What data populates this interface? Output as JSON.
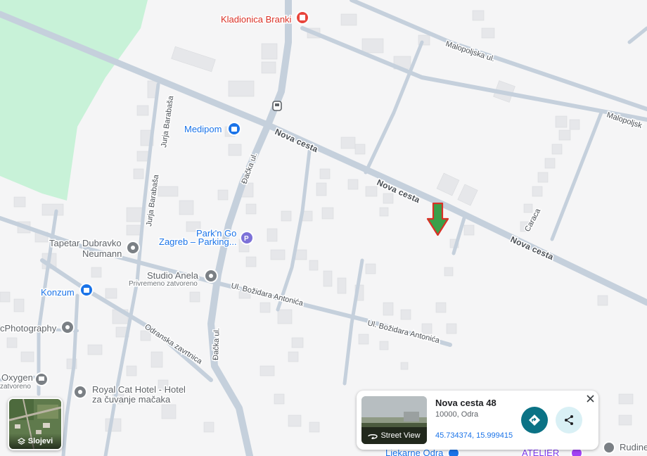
{
  "map": {
    "poi": {
      "kladionica": "Kladionica Branki",
      "medipom": "Medipom",
      "parkngo_line1": "Park'n Go",
      "parkngo_line2": "Zagreb – Parking...",
      "tapetar_line1": "Tapetar Dubravko",
      "tapetar_line2": "Neumann",
      "studio_anela": "Studio Anela",
      "studio_anela_status": "Privremeno zatvoreno",
      "konzum": "Konzum",
      "photography": "cPhotography",
      "oxygen": "Oxygen",
      "oxygen_status": "zatvoreno",
      "royal_cat_line1": "Royal Cat Hotel - Hotel",
      "royal_cat_line2": "za čuvanje mačaka",
      "ljekarne": "Ljekarne Odra",
      "atelier": "ATELIER",
      "rudine": "Rudine"
    },
    "roads": {
      "nova_cesta": "Nova cesta",
      "malopoljska_ul": "Malopoljska ul.",
      "malopoljska_short": "Malopoljsk",
      "dacka_ul": "Đačka ul.",
      "jurja_barabasa": "Jurja Barabaša",
      "ul_bozidara_antonica": "Ul. Božidara Antonića",
      "odranska_zavrtnica": "Odranska zavrtnica",
      "caraca": "Caraca"
    },
    "colors": {
      "background": "#f5f5f6",
      "road": "#c5d0dc",
      "park": "#c8f2d8",
      "building": "#e6e7ea",
      "marker_green": "#3aa04a",
      "marker_red": "#d93025"
    },
    "marker_icon": "green-arrow-down-marker"
  },
  "place_card": {
    "title": "Nova cesta 48",
    "subtitle": "10000, Odra",
    "coordinates": "45.734374, 15.999415",
    "street_view_label": "Street View",
    "close_icon": "close-icon",
    "directions_icon": "directions-icon",
    "share_icon": "share-icon"
  },
  "layers": {
    "label": "Slojevi",
    "icon": "layers-icon"
  }
}
